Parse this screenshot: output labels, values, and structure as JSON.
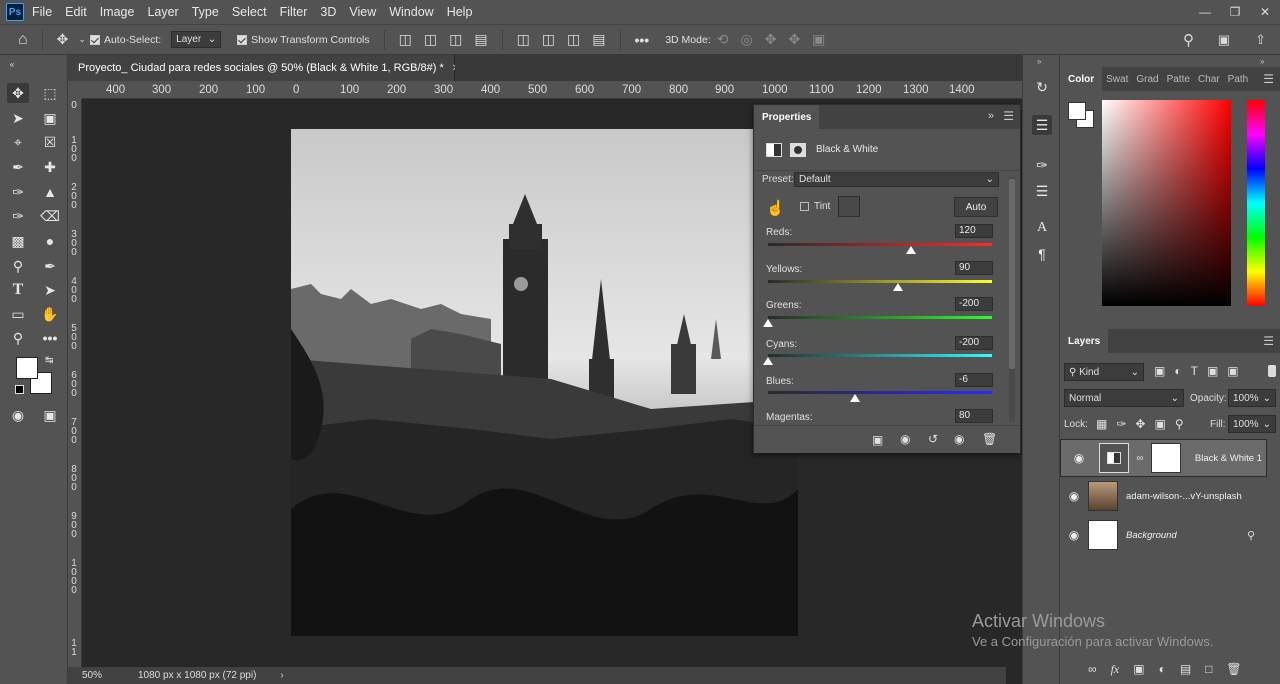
{
  "menubar": {
    "logo": "Ps",
    "items": [
      "File",
      "Edit",
      "Image",
      "Layer",
      "Type",
      "Select",
      "Filter",
      "3D",
      "View",
      "Window",
      "Help"
    ],
    "window_controls": [
      "minimize-icon",
      "restore-icon",
      "close-icon"
    ]
  },
  "options": {
    "auto_select_label": "Auto-Select:",
    "auto_select_checked": true,
    "layer_select": "Layer",
    "transform_label": "Show Transform Controls",
    "transform_checked": true,
    "mode_3d_label": "3D Mode:"
  },
  "document": {
    "tab_title": "Proyecto_ Ciudad para redes sociales @ 50% (Black & White 1, RGB/8#) *",
    "zoom": "50%",
    "dimensions": "1080 px x 1080 px (72 ppi)"
  },
  "ruler": {
    "h_labels": [
      "400",
      "300",
      "200",
      "100",
      "0",
      "100",
      "200",
      "300",
      "400",
      "500",
      "600",
      "700",
      "800",
      "900",
      "1000",
      "1100",
      "1200",
      "1300",
      "1400"
    ],
    "v_labels": [
      "0",
      "1",
      "0",
      "0",
      "2",
      "0",
      "0",
      "3",
      "0",
      "0",
      "4",
      "0",
      "0",
      "5",
      "0",
      "0",
      "6",
      "0",
      "0",
      "7",
      "0",
      "0",
      "8",
      "0",
      "0",
      "9",
      "0",
      "0",
      "1",
      "0",
      "0",
      "0",
      "1",
      "1"
    ]
  },
  "properties": {
    "tab": "Properties",
    "adjustment_name": "Black & White",
    "preset_label": "Preset:",
    "preset_value": "Default",
    "tint_label": "Tint",
    "tint_checked": false,
    "auto_label": "Auto",
    "sliders": [
      {
        "label": "Reds:",
        "value": "120",
        "fraction": 0.64,
        "from": "#2a2a2a",
        "to": "#ff2a2a"
      },
      {
        "label": "Yellows:",
        "value": "90",
        "fraction": 0.58,
        "from": "#2a2a2a",
        "to": "#ffff2a"
      },
      {
        "label": "Greens:",
        "value": "-200",
        "fraction": 0.0,
        "from": "#2a2a2a",
        "to": "#2aff2a"
      },
      {
        "label": "Cyans:",
        "value": "-200",
        "fraction": 0.0,
        "from": "#2a2a2a",
        "to": "#2affff"
      },
      {
        "label": "Blues:",
        "value": "-6",
        "fraction": 0.39,
        "from": "#2a2a2a",
        "to": "#2a2aff"
      },
      {
        "label": "Magentas:",
        "value": "80"
      }
    ]
  },
  "color_panel": {
    "tabs": [
      "Color",
      "Swat",
      "Grad",
      "Patte",
      "Char",
      "Path"
    ]
  },
  "layers_panel": {
    "tab": "Layers",
    "filter_kind": "Kind",
    "blend_mode": "Normal",
    "opacity_label": "Opacity:",
    "opacity_value": "100%",
    "lock_label": "Lock:",
    "fill_label": "Fill:",
    "fill_value": "100%",
    "layers": [
      {
        "name": "Black & White 1",
        "selected": true
      },
      {
        "name": "adam-wilson-...vY-unsplash",
        "selected": false
      },
      {
        "name": "Background",
        "selected": false,
        "locked": true
      }
    ]
  },
  "watermark": {
    "title": "Activar Windows",
    "subtitle": "Ve a Configuración para activar Windows."
  }
}
